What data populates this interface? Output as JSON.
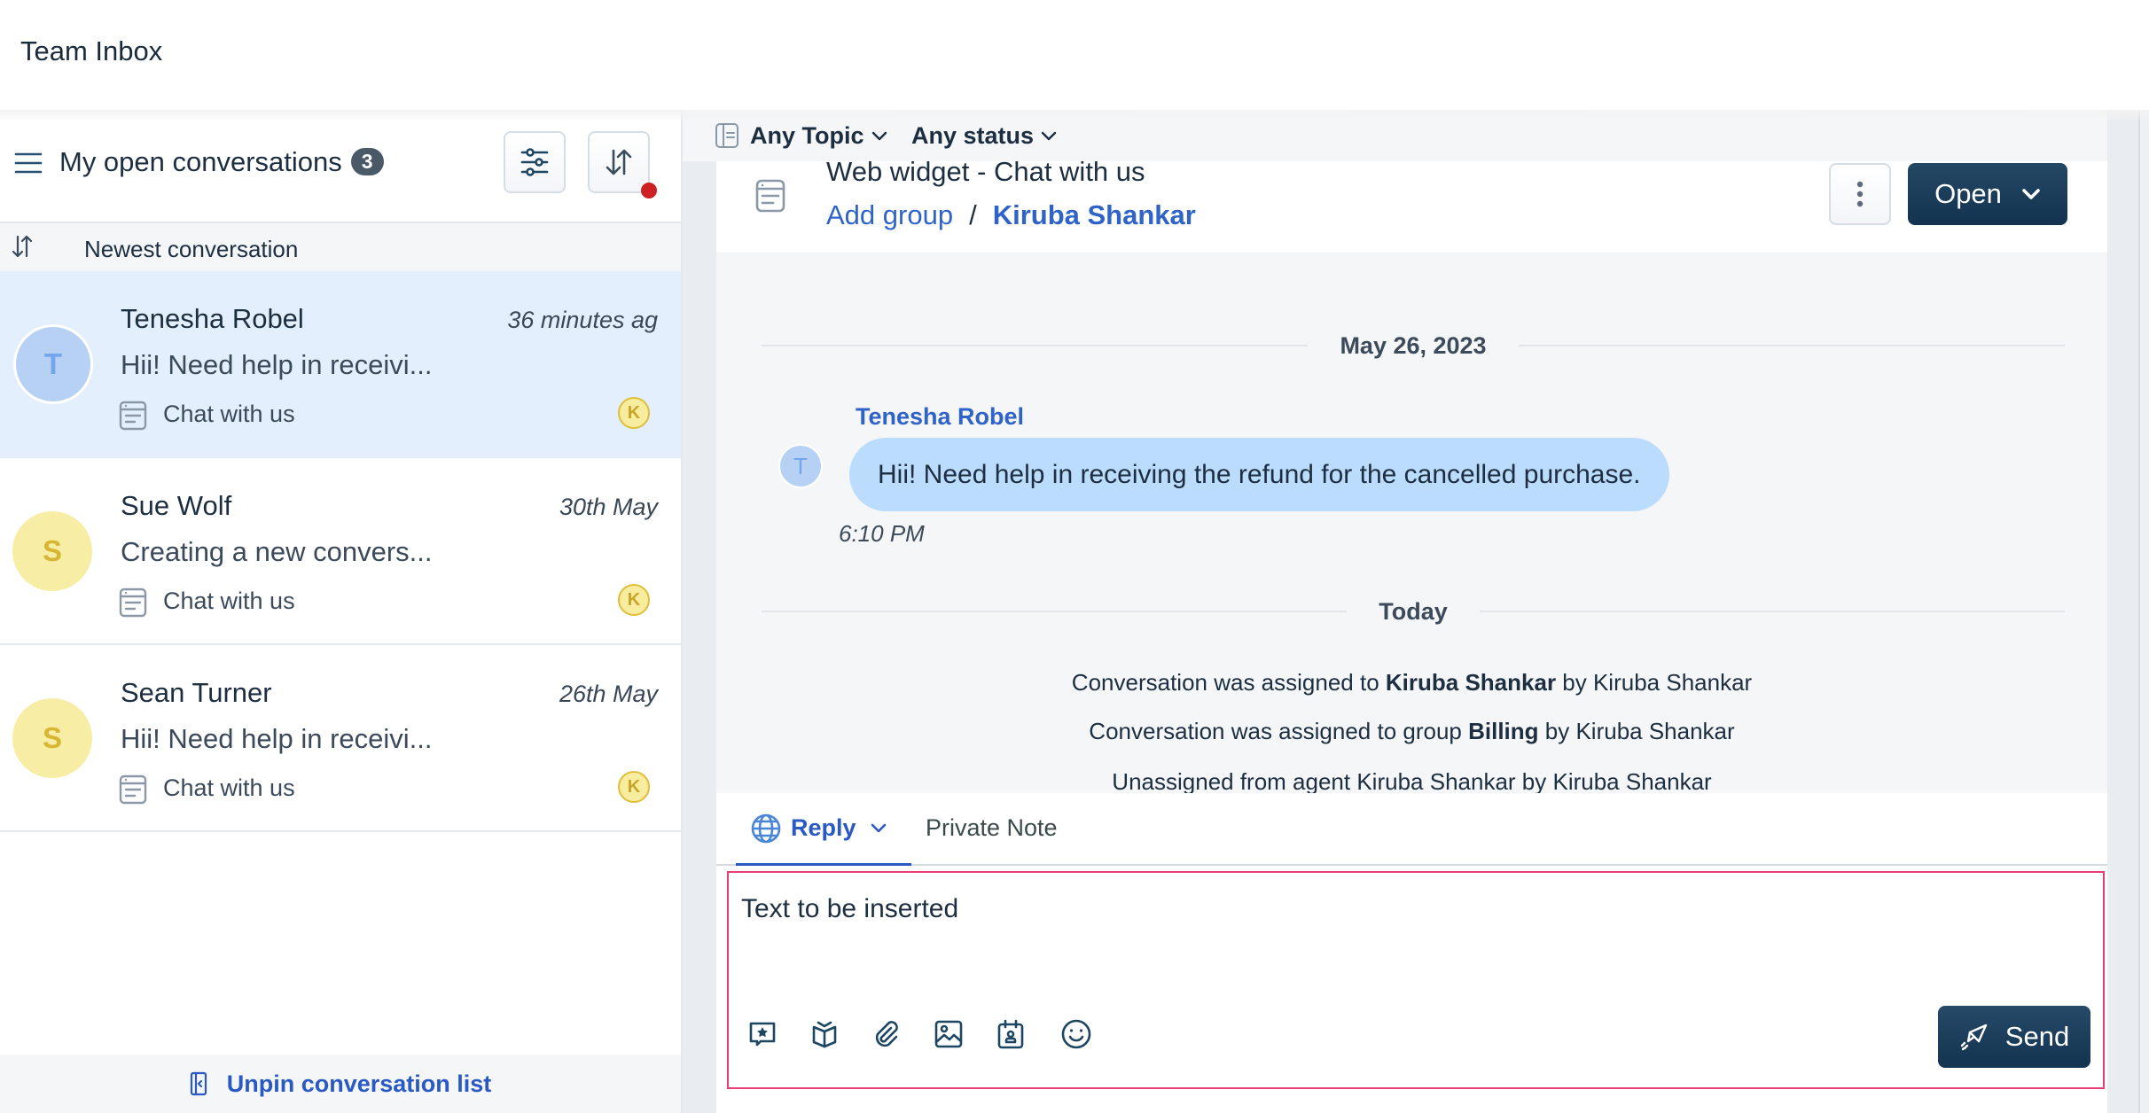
{
  "header": {
    "title": "Team Inbox"
  },
  "list": {
    "title": "My open conversations",
    "count": "3",
    "menu_icon": "hamburger-icon",
    "filter_icon": "sliders-icon",
    "sort_icon": "sort-arrows-icon",
    "sort_label": "Newest conversation",
    "unpin_label": "Unpin conversation list",
    "conversations": [
      {
        "name": "Tenesha Robel",
        "initial": "T",
        "time": "36 minutes ag",
        "preview": "Hii! Need help in receivi...",
        "inbox": "Chat with us",
        "agent_initial": "K",
        "selected": true,
        "avatar_color": "#b7d1f4"
      },
      {
        "name": "Sue Wolf",
        "initial": "S",
        "time": "30th May",
        "preview": "Creating a new convers...",
        "inbox": "Chat with us",
        "agent_initial": "K",
        "selected": false,
        "avatar_color": "#f7eda5"
      },
      {
        "name": "Sean Turner",
        "initial": "S",
        "time": "26th May",
        "preview": "Hii! Need help in receivi...",
        "inbox": "Chat with us",
        "agent_initial": "K",
        "selected": false,
        "avatar_color": "#f7eda5"
      }
    ]
  },
  "filters": {
    "topic": "Any Topic",
    "status": "Any status"
  },
  "conversation": {
    "inbox_name": "Web widget - Chat with us",
    "add_group": "Add group",
    "separator": "/",
    "assignee": "Kiruba Shankar",
    "status_button": "Open",
    "date_1": "May 26, 2023",
    "message": {
      "sender": "Tenesha Robel",
      "initial": "T",
      "text": "Hii! Need help in receiving the refund for the cancelled purchase.",
      "time": "6:10 PM"
    },
    "date_2": "Today",
    "activities": [
      {
        "pre": "Conversation was assigned to ",
        "bold": "Kiruba Shankar",
        "post": " by Kiruba Shankar"
      },
      {
        "pre": "Conversation was assigned to group ",
        "bold": "Billing",
        "post": " by Kiruba Shankar"
      },
      {
        "pre": "Unassigned from agent Kiruba Shankar by Kiruba Shankar",
        "bold": "",
        "post": ""
      }
    ]
  },
  "reply": {
    "tab_reply": "Reply",
    "tab_private_note": "Private Note",
    "editor_text": "Text to be inserted",
    "send_label": "Send",
    "toolbar_icons": [
      "canned-response-icon",
      "knowledge-base-icon",
      "attachment-icon",
      "image-icon",
      "calendar-icon",
      "emoji-icon"
    ]
  },
  "colors": {
    "accent_blue": "#2f63c8",
    "primary_dark": "#173a57",
    "selected_row": "#e3effc",
    "editor_border": "#ea3d73",
    "notification_dot": "#cc2024"
  }
}
